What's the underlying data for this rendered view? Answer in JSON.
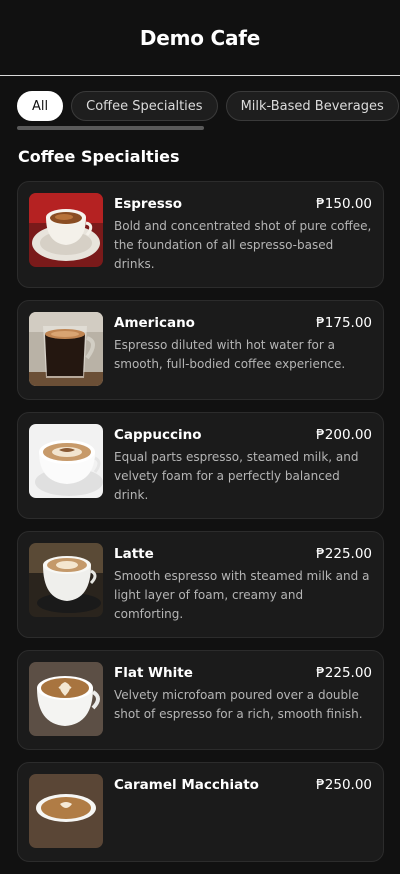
{
  "header": {
    "title": "Demo Cafe"
  },
  "filters": [
    {
      "label": "All",
      "active": true
    },
    {
      "label": "Coffee Specialties",
      "active": false
    },
    {
      "label": "Milk-Based Beverages",
      "active": false
    }
  ],
  "section": {
    "title": "Coffee Specialties"
  },
  "items": [
    {
      "name": "Espresso",
      "price": "₱150.00",
      "description": "Bold and concentrated shot of pure coffee, the foundation of all espresso-based drinks.",
      "image": "espresso-cup-photo"
    },
    {
      "name": "Americano",
      "price": "₱175.00",
      "description": "Espresso diluted with hot water for a smooth, full-bodied coffee experience.",
      "image": "americano-glass-photo"
    },
    {
      "name": "Cappuccino",
      "price": "₱200.00",
      "description": "Equal parts espresso, steamed milk, and velvety foam for a perfectly balanced drink.",
      "image": "cappuccino-cup-photo"
    },
    {
      "name": "Latte",
      "price": "₱225.00",
      "description": "Smooth espresso with steamed milk and a light layer of foam, creamy and comforting.",
      "image": "latte-cup-photo"
    },
    {
      "name": "Flat White",
      "price": "₱225.00",
      "description": "Velvety microfoam poured over a double shot of espresso for a rich, smooth finish.",
      "image": "flat-white-cup-photo"
    },
    {
      "name": "Caramel Macchiato",
      "price": "₱250.00",
      "description": "",
      "image": "caramel-macchiato-photo"
    }
  ],
  "colors": {
    "background": "#111111",
    "card": "#1b1b1b",
    "active_chip": "#ffffff"
  }
}
